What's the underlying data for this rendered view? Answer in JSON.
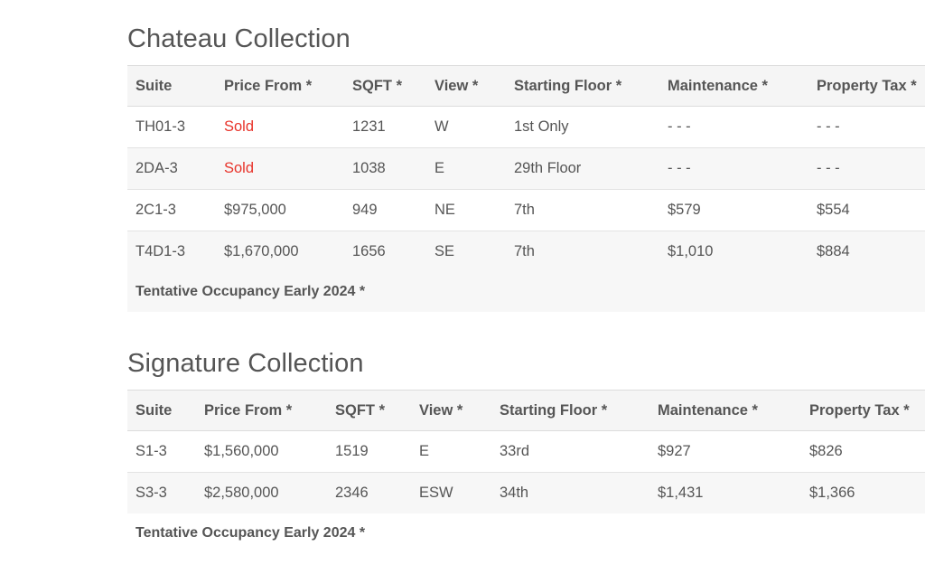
{
  "chateau": {
    "title": "Chateau Collection",
    "headers": [
      "Suite",
      "Price From *",
      "SQFT *",
      "View *",
      "Starting Floor *",
      "Maintenance *",
      "Property Tax *"
    ],
    "rows": [
      {
        "suite": "TH01-3",
        "price": "Sold",
        "sqft": "1231",
        "view": "W",
        "floor": "1st Only",
        "maintenance": "- - -",
        "tax": "- - -"
      },
      {
        "suite": "2DA-3",
        "price": "Sold",
        "sqft": "1038",
        "view": "E",
        "floor": "29th Floor",
        "maintenance": "- - -",
        "tax": "- - -"
      },
      {
        "suite": "2C1-3",
        "price": "$975,000",
        "sqft": "949",
        "view": "NE",
        "floor": "7th",
        "maintenance": "$579",
        "tax": "$554"
      },
      {
        "suite": "T4D1-3",
        "price": "$1,670,000",
        "sqft": "1656",
        "view": "SE",
        "floor": "7th",
        "maintenance": "$1,010",
        "tax": "$884"
      }
    ],
    "note": "Tentative Occupancy Early 2024 *"
  },
  "signature": {
    "title": "Signature Collection",
    "headers": [
      "Suite",
      "Price From *",
      "SQFT *",
      "View *",
      "Starting Floor *",
      "Maintenance *",
      "Property Tax *"
    ],
    "rows": [
      {
        "suite": "S1-3",
        "price": "$1,560,000",
        "sqft": "1519",
        "view": "E",
        "floor": "33rd",
        "maintenance": "$927",
        "tax": "$826"
      },
      {
        "suite": "S3-3",
        "price": "$2,580,000",
        "sqft": "2346",
        "view": "ESW",
        "floor": "34th",
        "maintenance": "$1,431",
        "tax": "$1,366"
      }
    ],
    "note": "Tentative Occupancy Early 2024 *"
  },
  "colors": {
    "text": "#555555",
    "sold": "#e8332a",
    "header_bg": "#f5f5f5",
    "stripe_bg": "#f7f7f7"
  }
}
